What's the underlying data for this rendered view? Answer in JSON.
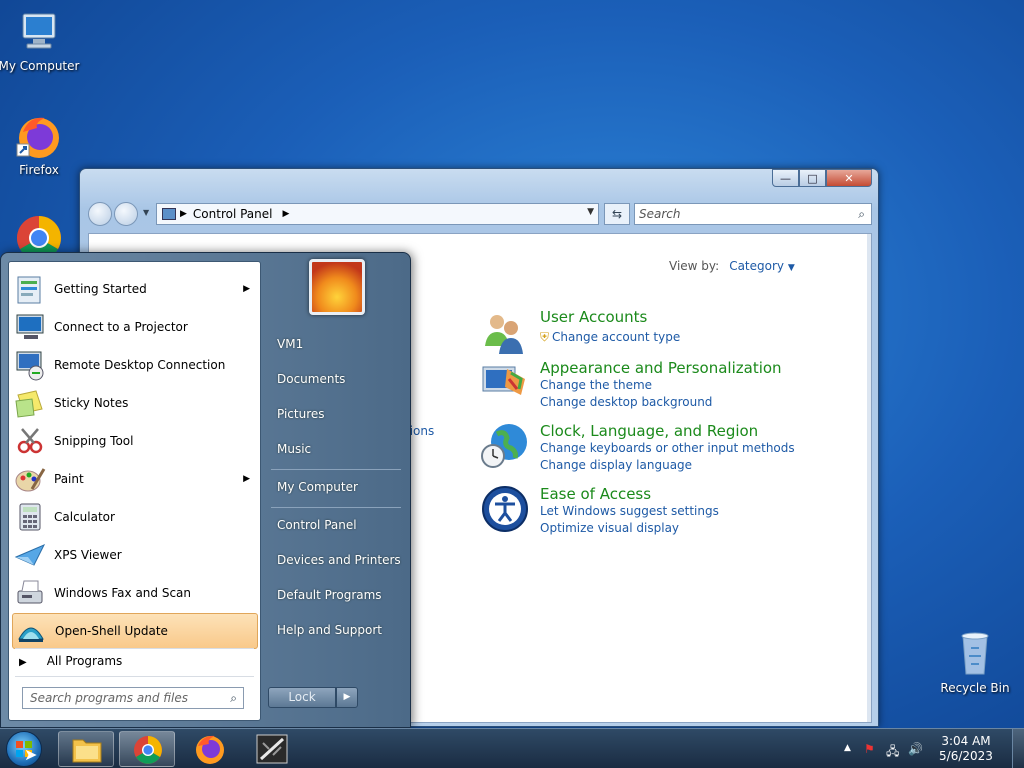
{
  "desktop": {
    "icons": [
      {
        "label": "My Computer",
        "icon": "computer-icon"
      },
      {
        "label": "Firefox",
        "icon": "firefox-icon"
      },
      {
        "label": "",
        "icon": "chrome-icon"
      },
      {
        "label": "Recycle Bin",
        "icon": "recycle-bin-icon"
      }
    ]
  },
  "control_panel": {
    "breadcrumb": "Control Panel",
    "search_placeholder": "Search",
    "view_by_label": "View by:",
    "view_by_value": "Category",
    "partial_text": "tions",
    "categories": [
      {
        "title": "User Accounts",
        "icon": "user-accounts-icon",
        "links": [
          "Change account type"
        ]
      },
      {
        "title": "Appearance and Personalization",
        "icon": "appearance-icon",
        "links": [
          "Change the theme",
          "Change desktop background"
        ]
      },
      {
        "title": "Clock, Language, and Region",
        "icon": "clock-globe-icon",
        "links": [
          "Change keyboards or other input methods",
          "Change display language"
        ]
      },
      {
        "title": "Ease of Access",
        "icon": "ease-of-access-icon",
        "links": [
          "Let Windows suggest settings",
          "Optimize visual display"
        ]
      }
    ]
  },
  "start_menu": {
    "programs": [
      {
        "label": "Getting Started",
        "icon": "getting-started-icon",
        "submenu": true
      },
      {
        "label": "Connect to a Projector",
        "icon": "projector-icon",
        "submenu": false
      },
      {
        "label": "Remote Desktop Connection",
        "icon": "remote-desktop-icon",
        "submenu": false
      },
      {
        "label": "Sticky Notes",
        "icon": "sticky-notes-icon",
        "submenu": false
      },
      {
        "label": "Snipping Tool",
        "icon": "snipping-tool-icon",
        "submenu": false
      },
      {
        "label": "Paint",
        "icon": "paint-icon",
        "submenu": true
      },
      {
        "label": "Calculator",
        "icon": "calculator-icon",
        "submenu": false
      },
      {
        "label": "XPS Viewer",
        "icon": "xps-viewer-icon",
        "submenu": false
      },
      {
        "label": "Windows Fax and Scan",
        "icon": "fax-scan-icon",
        "submenu": false
      },
      {
        "label": "Open-Shell Update",
        "icon": "open-shell-icon",
        "submenu": false
      }
    ],
    "all_programs": "All Programs",
    "search_placeholder": "Search programs and files",
    "right_items": [
      "VM1",
      "Documents",
      "Pictures",
      "Music",
      "My Computer",
      "Control Panel",
      "Devices and Printers",
      "Default Programs",
      "Help and Support"
    ],
    "lock_label": "Lock"
  },
  "taskbar": {
    "pinned": [
      "file-explorer-icon",
      "chrome-icon",
      "firefox-icon",
      "app-icon"
    ],
    "time": "3:04 AM",
    "date": "5/6/2023"
  }
}
